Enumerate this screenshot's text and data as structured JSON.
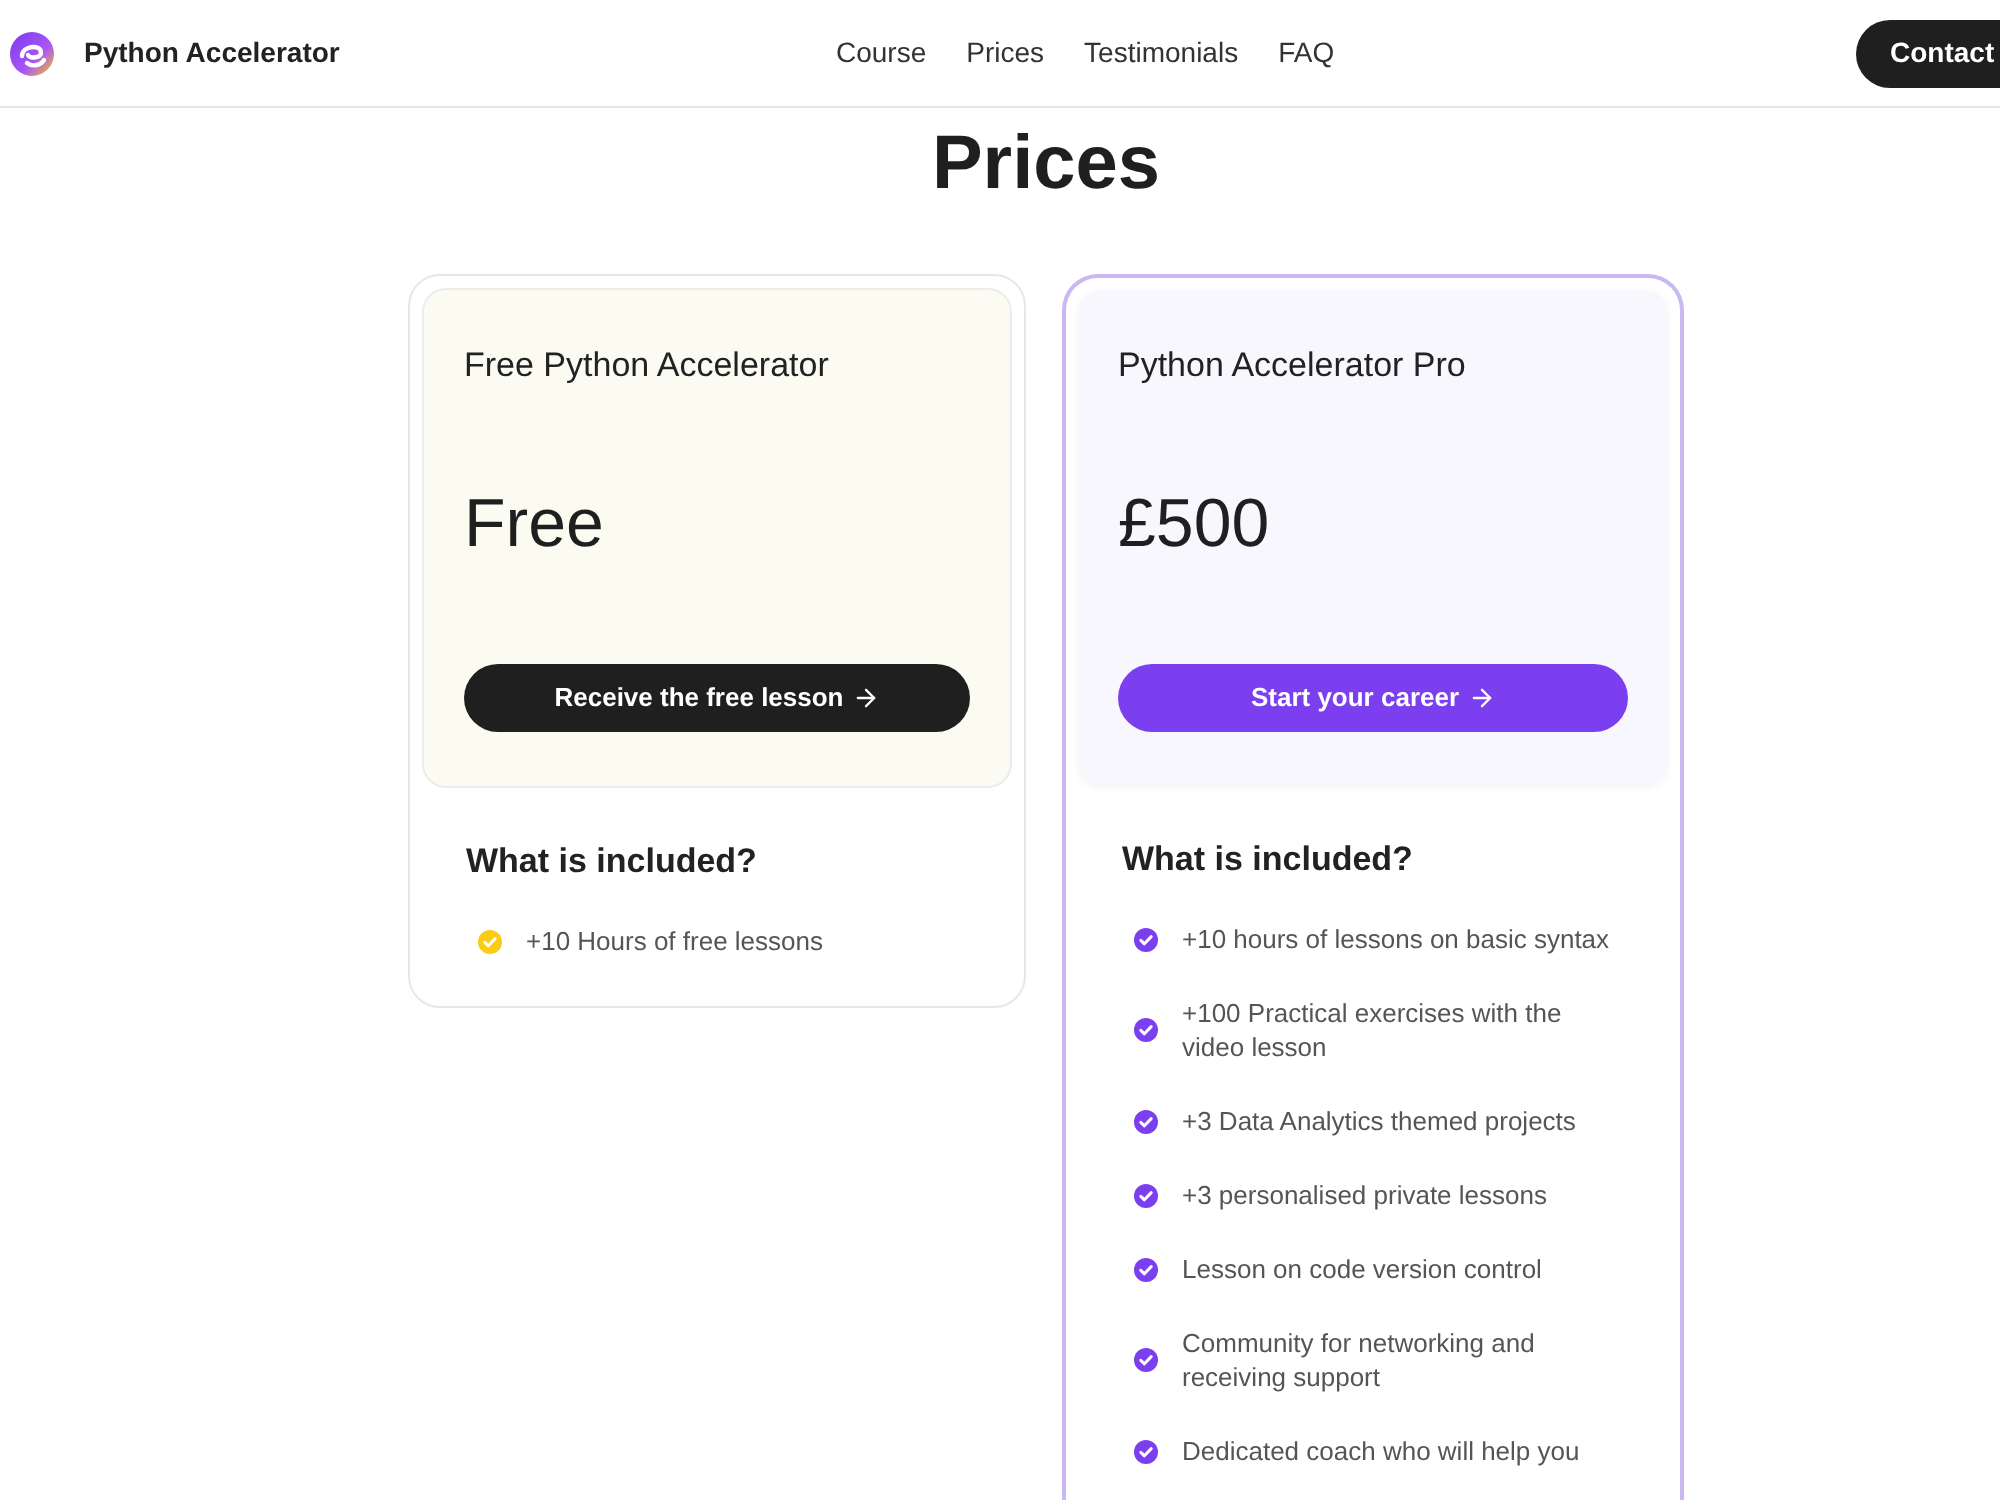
{
  "header": {
    "brand": "Python Accelerator",
    "nav": [
      {
        "label": "Course"
      },
      {
        "label": "Prices"
      },
      {
        "label": "Testimonials"
      },
      {
        "label": "FAQ"
      }
    ],
    "contact_button": "Contact"
  },
  "section_title": "Prices",
  "plans": [
    {
      "kind": "basic",
      "name": "Free Python Accelerator",
      "price": "Free",
      "button": "Receive the free lesson",
      "included_title": "What is included?",
      "features": [
        "+10 Hours of free lessons"
      ]
    },
    {
      "kind": "pro",
      "name": "Python Accelerator Pro",
      "price": "£500",
      "button": "Start your career",
      "included_title": "What is included?",
      "features": [
        "+10 hours of lessons on basic syntax",
        "+100 Practical exercises with the video lesson",
        "+3 Data Analytics themed projects",
        "+3 personalised private lessons",
        "Lesson on code version control",
        "Community for networking and receiving support",
        "Dedicated coach who will help you"
      ]
    }
  ]
}
